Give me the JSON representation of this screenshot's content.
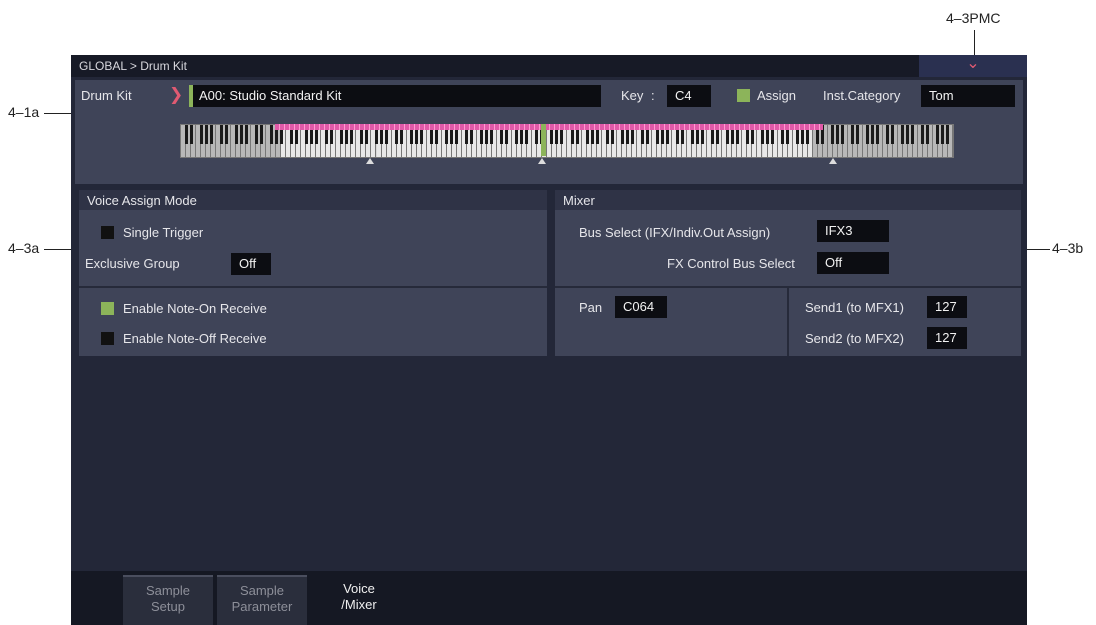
{
  "callouts": {
    "pmc": "4–3PMC",
    "left_top": "4–1a",
    "left_mid": "4–3a",
    "right_mid": "4–3b"
  },
  "header": {
    "breadcrumb": "GLOBAL > Drum Kit",
    "pmc_icon": "chevron-down-icon"
  },
  "drumkit": {
    "label": "Drum Kit",
    "name": "A00: Studio Standard Kit",
    "key_label": "Key",
    "key_sep": ":",
    "key_value": "C4",
    "assign_label": "Assign",
    "assign_checked": true,
    "inst_category_label": "Inst.Category",
    "inst_category_value": "Tom"
  },
  "voice_assign": {
    "title": "Voice Assign Mode",
    "single_trigger_label": "Single Trigger",
    "single_trigger_checked": false,
    "exclusive_group_label": "Exclusive Group",
    "exclusive_group_value": "Off",
    "note_on_label": "Enable Note-On  Receive",
    "note_on_checked": true,
    "note_off_label": "Enable Note-Off Receive",
    "note_off_checked": false
  },
  "mixer": {
    "title": "Mixer",
    "bus_select_label": "Bus Select (IFX/Indiv.Out Assign)",
    "bus_select_value": "IFX3",
    "fx_ctrl_label": "FX Control Bus Select",
    "fx_ctrl_value": "Off",
    "pan_label": "Pan",
    "pan_value": "C064",
    "send1_label": "Send1 (to MFX1)",
    "send1_value": "127",
    "send2_label": "Send2 (to MFX2)",
    "send2_value": "127"
  },
  "tabs": [
    {
      "line1": "Sample",
      "line2": "Setup"
    },
    {
      "line1": "Sample",
      "line2": "Parameter"
    },
    {
      "line1": "Voice",
      "line2": "/Mixer"
    }
  ],
  "colors": {
    "accent_green": "#8cb45a",
    "accent_pink": "#e05a72",
    "bg": "#232738"
  }
}
